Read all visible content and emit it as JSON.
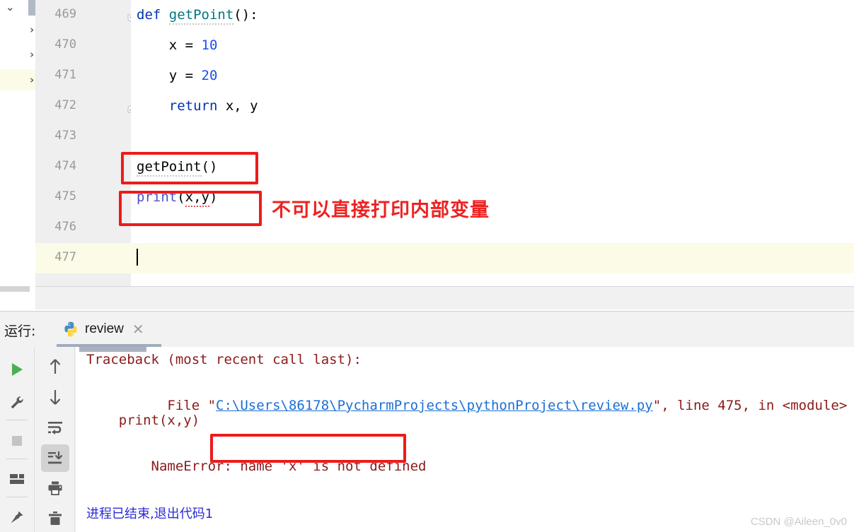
{
  "editor": {
    "line_numbers": [
      "469",
      "470",
      "471",
      "472",
      "473",
      "474",
      "475",
      "476",
      "477"
    ],
    "lines": [
      {
        "num": "469",
        "tokens": [
          {
            "t": "def ",
            "c": "kw"
          },
          {
            "t": "getPoint",
            "c": "fn squig-gray"
          },
          {
            "t": "():",
            "c": ""
          }
        ]
      },
      {
        "num": "470",
        "tokens": [
          {
            "t": "    x = ",
            "c": ""
          },
          {
            "t": "10",
            "c": "num"
          }
        ]
      },
      {
        "num": "471",
        "tokens": [
          {
            "t": "    y = ",
            "c": ""
          },
          {
            "t": "20",
            "c": "num"
          }
        ]
      },
      {
        "num": "472",
        "tokens": [
          {
            "t": "    ",
            "c": ""
          },
          {
            "t": "return",
            "c": "kw"
          },
          {
            "t": " x, y",
            "c": ""
          }
        ]
      },
      {
        "num": "473",
        "tokens": []
      },
      {
        "num": "474",
        "tokens": [
          {
            "t": "getPoint",
            "c": "squig-gray"
          },
          {
            "t": "()",
            "c": ""
          }
        ]
      },
      {
        "num": "475",
        "tokens": [
          {
            "t": "print",
            "c": "bi"
          },
          {
            "t": "(",
            "c": ""
          },
          {
            "t": "x,y",
            "c": "squig-red"
          },
          {
            "t": ")",
            "c": ""
          }
        ]
      },
      {
        "num": "476",
        "tokens": []
      },
      {
        "num": "477",
        "tokens": []
      }
    ],
    "annotation_text": "不可以直接打印内部变量",
    "annotation_color": "#ee2222",
    "highlight_line": "477",
    "caret_line": "477"
  },
  "run_panel": {
    "label": "运行:",
    "tab_name": "review",
    "tab_icon": "python-icon",
    "tab_close_glyph": "✕",
    "toolbar_left": [
      {
        "name": "run-button",
        "icon": "play-icon"
      },
      {
        "name": "settings-button",
        "icon": "wrench-icon"
      },
      {
        "name": "stop-button",
        "icon": "stop-square-icon"
      },
      {
        "name": "layout-button",
        "icon": "layout-grid-icon"
      },
      {
        "name": "pin-button",
        "icon": "pin-icon"
      }
    ],
    "toolbar_right": [
      {
        "name": "up-button",
        "icon": "arrow-up-icon"
      },
      {
        "name": "down-button",
        "icon": "arrow-down-icon"
      },
      {
        "name": "soft-wrap-button",
        "icon": "soft-wrap-icon"
      },
      {
        "name": "scroll-to-end-button",
        "icon": "scroll-to-end-icon",
        "active": true
      },
      {
        "name": "print-button",
        "icon": "printer-icon"
      },
      {
        "name": "clear-button",
        "icon": "trash-icon"
      }
    ],
    "console": {
      "traceback_header": "Traceback (most recent call last):",
      "file_prefix": "  File \"",
      "file_link": "C:\\Users\\86178\\PycharmProjects\\pythonProject\\review.py",
      "file_suffix": "\", line 475, in <module>",
      "code_line": "    print(x,y)",
      "error_prefix": "NameError: name ",
      "error_highlight": "'x' is not defined",
      "exit_message": "进程已结束,退出代码1",
      "error_color": "#8b1a1a",
      "link_color": "#1a6fd4",
      "exit_color": "#2b2bd6"
    }
  },
  "watermark": "CSDN @Aileen_0v0"
}
